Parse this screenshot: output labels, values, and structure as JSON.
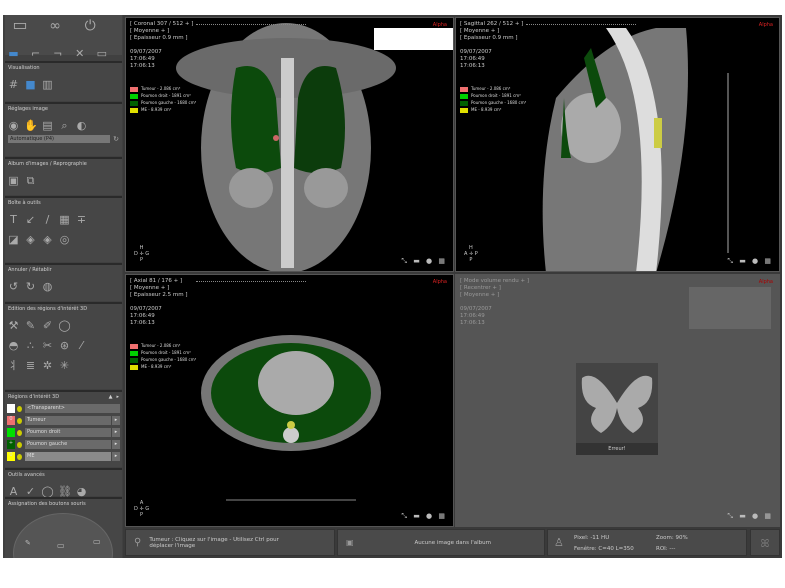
{
  "sidebar": {
    "sections": [
      {
        "title": "Visualisation"
      },
      {
        "title": "Réglages image",
        "select": "Automatique (P4)"
      },
      {
        "title": "Album d'images / Reprographie"
      },
      {
        "title": "Boîte à outils"
      },
      {
        "title": "Annuler / Rétablir"
      },
      {
        "title": "Edition des régions d'intérêt 3D"
      },
      {
        "title": "Régions d'intérêt 3D"
      },
      {
        "title": "Outils avancés"
      },
      {
        "title": "Assignation des boutons souris"
      }
    ],
    "rois": [
      {
        "label": "<Transparent>",
        "color": "#ffffff",
        "code": ""
      },
      {
        "label": "Tumeur",
        "color": "#f07070",
        "code": "0"
      },
      {
        "label": "Poumon droit",
        "color": "#00e000",
        "code": ""
      },
      {
        "label": "Poumon gauche",
        "color": "#006000",
        "code": "+"
      },
      {
        "label": "ME",
        "color": "#ffff00",
        "code": "0"
      }
    ]
  },
  "legend": [
    {
      "label": "Tumeur - 2.086 cm³",
      "color": "#f07070"
    },
    {
      "label": "Poumon droit - 1891 cm³",
      "color": "#00d000"
    },
    {
      "label": "Poumon gauche - 1680 cm³",
      "color": "#006000"
    },
    {
      "label": "ME - 8.939 cm³",
      "color": "#e0e000"
    }
  ],
  "viewports": {
    "coronal": {
      "l1": "[ Coronal 307 / 512 + ]",
      "l2": "[ Moyenne + ]",
      "l3": "[ Epaisseur 0.9 mm ]",
      "date": "09/07/2007",
      "t1": "17:06:49",
      "t2": "17:06:13",
      "alpha": "Alpha"
    },
    "sagittal": {
      "l1": "[ Sagittal 262 / 512 + ]",
      "l2": "[ Moyenne + ]",
      "l3": "[ Epaisseur 0.9 mm ]",
      "date": "09/07/2007",
      "t1": "17:06:49",
      "t2": "17:06:13",
      "alpha": "Alpha"
    },
    "axial": {
      "l1": "[ Axial 81 / 176 + ]",
      "l2": "[ Moyenne + ]",
      "l3": "[ Epaisseur 2.5 mm ]",
      "date": "09/07/2007",
      "t1": "17:06:49",
      "t2": "17:06:13",
      "alpha": "Alpha"
    },
    "volume": {
      "l1": "[ Mode volume rendu + ]",
      "l2": "[ Recentrer + ]",
      "l3": "[ Moyenne + ]",
      "date": "09/07/2007",
      "t1": "17:06:49",
      "t2": "17:06:13",
      "alpha": "Alpha",
      "error": "Erreur!"
    }
  },
  "status": {
    "hint": "Tumeur : Cliquez sur l'image - Utilisez Ctrl pour déplacer l'image",
    "album": "Aucune image dans l'album",
    "pixel": "Pixel: -11 HU",
    "window": "Fenêtre: C=40 L=350",
    "zoom": "Zoom: 90%",
    "roi": "ROI: ---"
  }
}
